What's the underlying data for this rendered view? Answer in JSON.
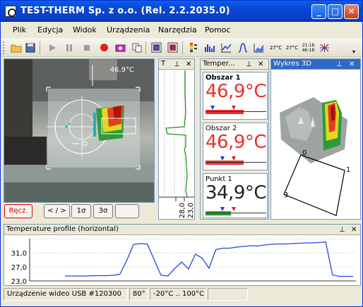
{
  "window": {
    "title": "TEST-THERM Sp. z o.o. (Rel. 2.2.2035.0)",
    "minimize_glyph": "_",
    "maximize_glyph": "□",
    "close_glyph": "✕"
  },
  "menu": [
    "Plik",
    "Edycja",
    "Widok",
    "Urządzenia",
    "Narzędzia",
    "Pomoc"
  ],
  "toolbar": {
    "icons": [
      "open-folder-icon",
      "save-disk-icon",
      "play-icon",
      "pause-icon",
      "stop-icon",
      "record-icon",
      "camera-icon",
      "copy-icon",
      "image-icon-1",
      "image-icon-2",
      "palette-icon",
      "histogram-icon",
      "line-chart-icon",
      "profile-icon",
      "area-chart-icon",
      "temp-unit-icon-1",
      "temp-unit-icon-2",
      "time-icon",
      "grid-icon"
    ],
    "text_icons": {
      "t1": "27°C",
      "t2": "27°C",
      "t3": "21:18\n46:18"
    }
  },
  "camera": {
    "overlay_temp": "46,9°C",
    "buttons": [
      "Ręcz.",
      "< / >",
      "1σ",
      "3σ",
      ""
    ]
  },
  "tstrip": {
    "header": "T",
    "scale_labels": [
      "28,0",
      "23,0"
    ]
  },
  "temp_panel": {
    "header": "Temper...",
    "cards": [
      {
        "name": "Obszar 1",
        "value": "46,9°C",
        "color": "#e8312b",
        "bar_color": "#e8312b"
      },
      {
        "name": "Obszar 2",
        "value": "46,9°C",
        "color": "#e8312b",
        "bar_color": "#e8312b"
      },
      {
        "name": "Punkt 1",
        "value": "34,9°C",
        "color": "#222222",
        "bar_color": "#2e9a2e"
      }
    ]
  },
  "panel_3d": {
    "header": "Wykres 3D",
    "axis_labels": [
      "0",
      "1",
      "3"
    ]
  },
  "profile": {
    "header": "Temperature profile (horizontal)",
    "ytick_labels": [
      "31,0",
      "27,0",
      "23,0"
    ]
  },
  "status": {
    "device": "Urządzenie wideo USB #120300",
    "angle": "80°",
    "range": "-20°C .. 100°C",
    "empty": ""
  },
  "chart_data": {
    "type": "line",
    "title": "Temperature profile (horizontal)",
    "xlabel": "",
    "ylabel": "",
    "ylim": [
      23,
      35
    ],
    "grid": true,
    "series": [
      {
        "values": [
          24.4,
          24.4,
          24.4,
          24.4,
          24.5,
          24.5,
          24.5,
          24.6,
          24.9,
          28.8,
          33.4,
          33.6,
          33.5,
          29.0,
          24.6,
          24.4,
          26.5,
          28.4,
          26.4,
          30.6,
          29.5,
          26.6,
          31.9,
          32.3,
          32.3,
          32.6,
          32.8,
          33.0,
          32.9,
          33.2,
          33.4,
          33.5,
          33.5,
          33.6,
          33.7,
          33.8,
          33.8,
          33.9,
          34.1,
          24.7,
          24.3,
          24.3,
          24.3
        ]
      }
    ]
  }
}
